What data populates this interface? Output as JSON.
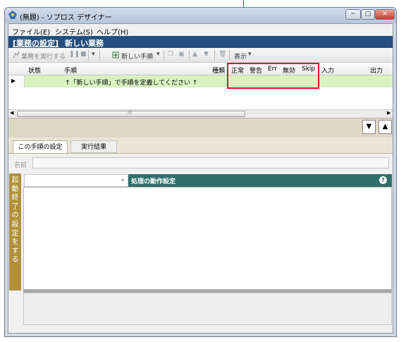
{
  "window": {
    "title": "(無題) - ソプロス デザイナー"
  },
  "menu": [
    "ファイル(E)",
    "システム(S)",
    "ヘルプ(H)"
  ],
  "header": {
    "settings_link": "[業務の設定]",
    "title": "新しい業務"
  },
  "toolbar": {
    "run_label": "業務を実行する",
    "new_step_label": "新しい手順",
    "display_label": "表示"
  },
  "grid": {
    "columns": [
      "状態",
      "手順",
      "種類",
      "正常",
      "警告",
      "Err",
      "無効",
      "Skip",
      "入力",
      "出力"
    ],
    "row_text": "↑「新しい手順」で手順を定義してください ↑"
  },
  "tabs": [
    "この手順の設定",
    "実行結果"
  ],
  "name_label": "名前",
  "side_label": "起動・終了の設定をする",
  "action_bar": {
    "label": "処理の動作設定"
  },
  "colors": {
    "header_bg": "#264f7f",
    "row_bg": "#d9f2c2",
    "highlight": "#e0142c",
    "side_label_bg": "#b28f3e",
    "action_bar_bg": "#2f6f6a"
  }
}
